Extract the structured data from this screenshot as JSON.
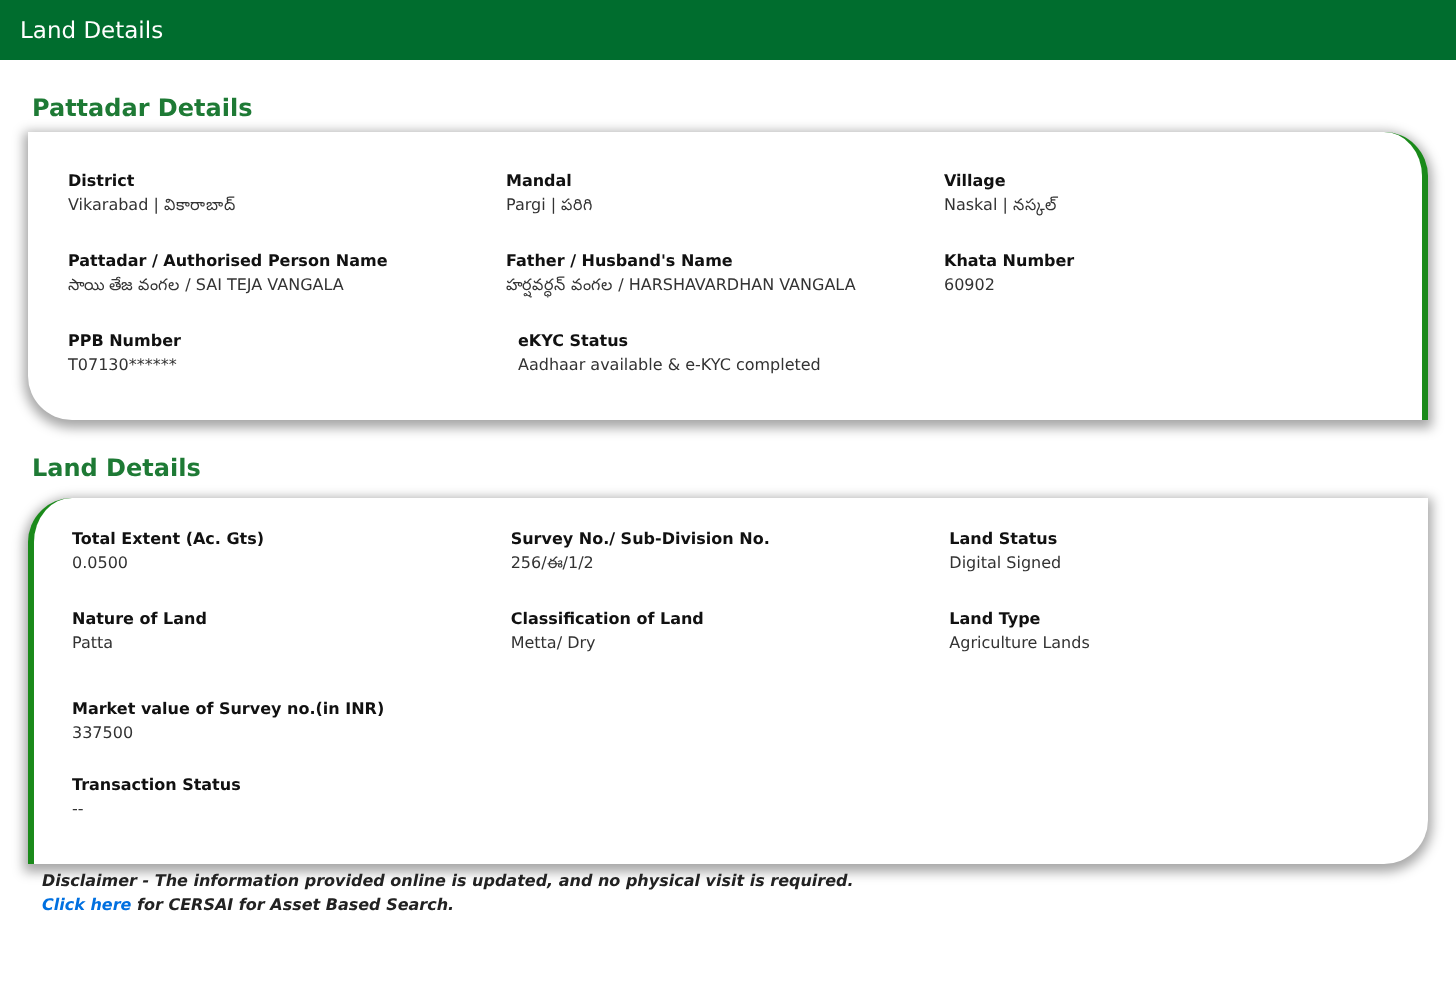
{
  "header": {
    "title": "Land Details"
  },
  "sections": [
    {
      "title": "Pattadar Details",
      "rows": [
        [
          {
            "label": "District",
            "value": "Vikarabad | వికారాబాద్"
          },
          {
            "label": "Mandal",
            "value": "Pargi | పరిగి"
          },
          {
            "label": "Village",
            "value": "Naskal | నస్కల్"
          }
        ],
        [
          {
            "label": "Pattadar / Authorised Person Name",
            "value": "సాయి తేజ వంగల / SAI TEJA VANGALA"
          },
          {
            "label": "Father / Husband's Name",
            "value": "హర్షవర్ధన్ వంగల / HARSHAVARDHAN VANGALA"
          },
          {
            "label": "Khata Number",
            "value": "60902"
          }
        ],
        [
          {
            "label": "PPB Number",
            "value": "T07130******"
          },
          {
            "label": "eKYC Status",
            "value": "Aadhaar available & e-KYC completed"
          }
        ]
      ]
    },
    {
      "title": "Land Details",
      "rows": [
        [
          {
            "label": "Total Extent (Ac. Gts)",
            "value": "0.0500"
          },
          {
            "label": "Survey No./ Sub-Division No.",
            "value": "256/ఈ/1/2"
          },
          {
            "label": "Land Status",
            "value": "Digital Signed"
          }
        ],
        [
          {
            "label": "Nature of Land",
            "value": "Patta"
          },
          {
            "label": "Classification of Land",
            "value": "Metta/ Dry"
          },
          {
            "label": "Land Type",
            "value": "Agriculture Lands"
          }
        ],
        [
          {
            "label": "Market value of Survey no.(in INR)",
            "value": "337500"
          }
        ],
        [
          {
            "label": "Transaction Status",
            "value": "--"
          }
        ]
      ]
    }
  ],
  "disclaimer": "Disclaimer - The information provided online is updated, and no physical visit is required.",
  "link": {
    "label": "Click here",
    "text": "for CERSAI for Asset Based Search."
  }
}
